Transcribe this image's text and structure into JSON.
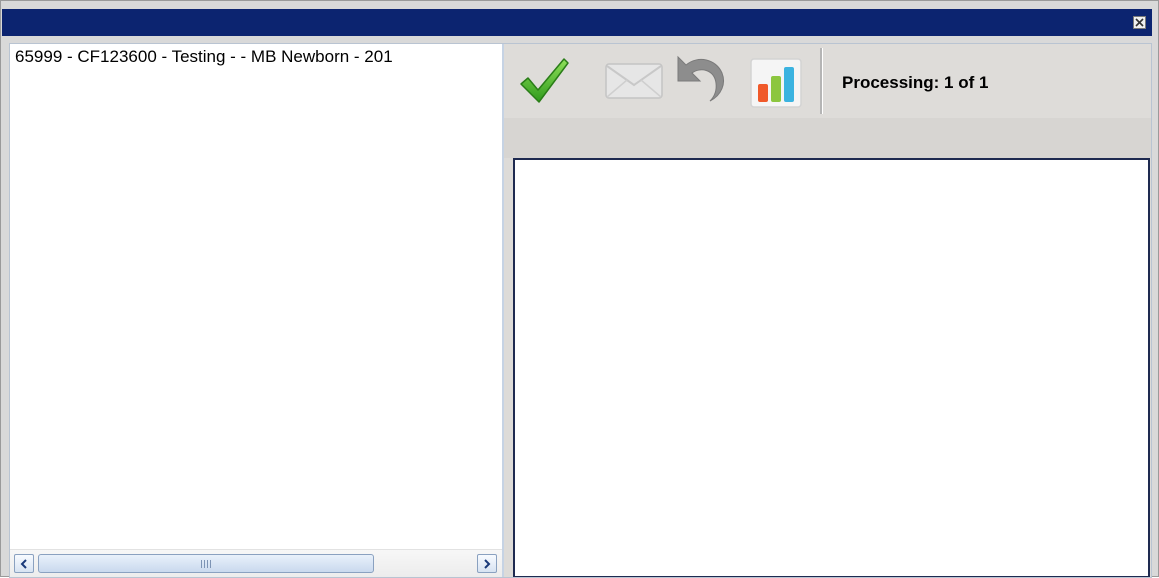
{
  "window": {
    "title": "",
    "close_icon": "close-icon",
    "title_color": "#0c2470"
  },
  "list": {
    "items": [
      {
        "label": "65999 - CF123600 - Testing  -  - MB Newborn - 201"
      }
    ]
  },
  "scrollbar": {
    "left_arrow": "chevron-left-icon",
    "right_arrow": "chevron-right-icon",
    "grip": "||||"
  },
  "toolbar": {
    "approve_icon": "checkmark-icon",
    "email_icon": "envelope-icon",
    "undo_icon": "undo-icon",
    "chart_icon": "bar-chart-icon",
    "status_text": "Processing: 1 of 1"
  },
  "colors": {
    "accent": "#0c2470",
    "check_green": "#49b22b",
    "chart_orange": "#f0592a",
    "chart_green": "#8cc63f",
    "chart_blue": "#3bb3e0"
  }
}
